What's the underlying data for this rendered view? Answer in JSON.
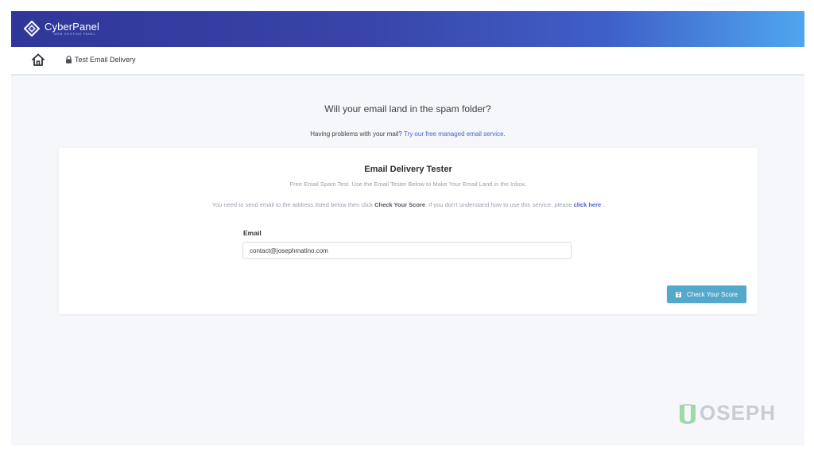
{
  "topbar": {
    "brand_name": "CyberPanel",
    "brand_tagline": "WEB HOSTING PANEL"
  },
  "breadcrumb": {
    "home_icon": "home-icon",
    "item_icon": "lock-icon",
    "label": "Test Email Delivery"
  },
  "main": {
    "title": "Will your email land in the spam folder?",
    "subtitle_prefix": "Having problems with your mail?",
    "subtitle_link": "Try our free managed email service."
  },
  "card": {
    "title": "Email Delivery Tester",
    "subtitle": "Free Email Spam Test. Use the Email Tester Below to Make Your Email Land in the Inbox.",
    "instr_1": "You need to send email to the address listed below then click ",
    "instr_strong": "Check Your Score",
    "instr_2": ". If you don't understand how to use this service, please ",
    "instr_link": "click here",
    "instr_3": " .",
    "email_label": "Email",
    "email_value": "contact@josephmatino.com",
    "button_label": "Check Your Score",
    "button_icon": "save-icon"
  },
  "watermark": {
    "text": "OSEPH",
    "mark": "J"
  },
  "colors": {
    "header_start": "#2f3699",
    "header_end": "#4fa6ee",
    "link": "#4a63c9",
    "button": "#52a9cc",
    "watermark_mark": "#8fd49a"
  }
}
